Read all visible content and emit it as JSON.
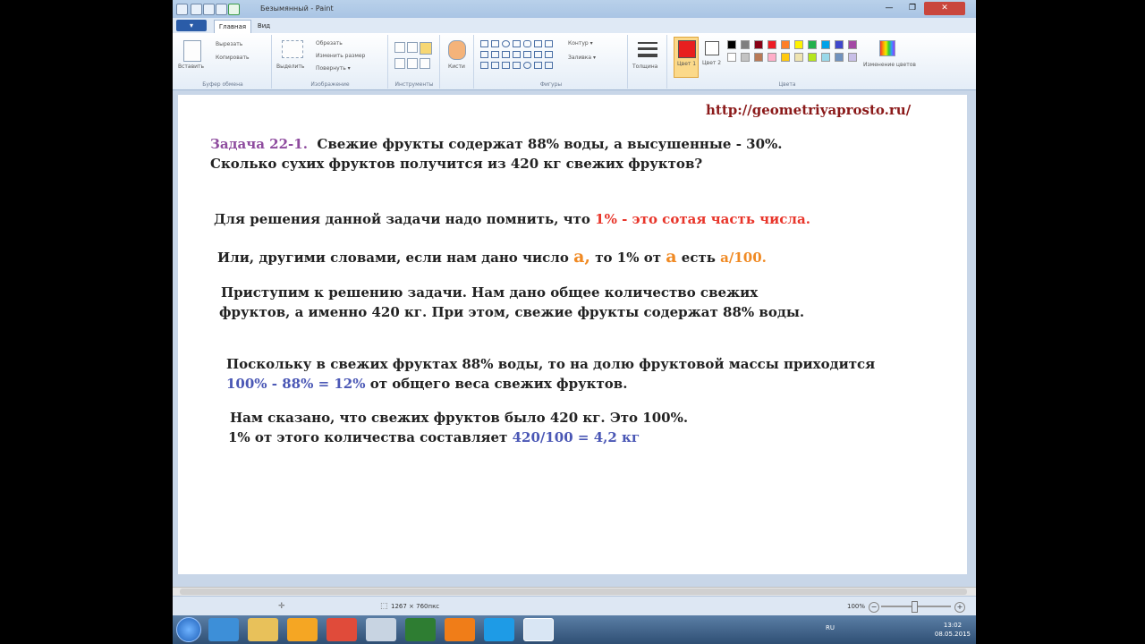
{
  "window": {
    "title": "Безымянный - Paint",
    "controls": [
      "—",
      "❐",
      "✕"
    ]
  },
  "tabs": {
    "file_label": "▾",
    "items": [
      "Главная",
      "Вид"
    ]
  },
  "ribbon": {
    "clipboard": {
      "paste": "Вставить",
      "cut": "Вырезать",
      "copy": "Копировать",
      "label": "Буфер обмена"
    },
    "image": {
      "select": "Выделить",
      "crop": "Обрезать",
      "resize": "Изменить размер",
      "rotate": "Повернуть ▾",
      "label": "Изображение"
    },
    "tools": {
      "label": "Инструменты"
    },
    "brushes": {
      "label": "Кисти"
    },
    "shapes": {
      "contour": "Контур ▾",
      "fill": "Заливка ▾",
      "label": "Фигуры"
    },
    "size": {
      "label": "Толщина"
    },
    "colors": {
      "color1": "Цвет 1",
      "color2": "Цвет 2",
      "edit": "Изменение цветов",
      "label": "Цвета",
      "color1_hex": "#e81f1f",
      "color2_hex": "#ffffff",
      "palette": [
        "#000000",
        "#7f7f7f",
        "#880015",
        "#ed1c24",
        "#ff7f27",
        "#fff200",
        "#22b14c",
        "#00a2e8",
        "#3f48cc",
        "#a349a4",
        "#ffffff",
        "#c3c3c3",
        "#b97a57",
        "#ffaec9",
        "#ffc90e",
        "#efe4b0",
        "#b5e61d",
        "#99d9ea",
        "#7092be",
        "#c8bfe7"
      ]
    }
  },
  "canvas": {
    "url": "http://geometriyaprosto.ru/",
    "task_label": "Задача 22-1.",
    "task_text": "Свежие фрукты содержат 88% воды, а высушенные - 30%.",
    "task_text2": "Сколько сухих фруктов получится из 420 кг свежих фруктов?",
    "p1_text": "Для решения данной задачи надо помнить, что",
    "p1_highlight": "1% - это сотая часть числа.",
    "p2_a": "Или, другими словами, если нам дано число",
    "p2_var1": "a,",
    "p2_b": "то 1% от",
    "p2_var2": "a",
    "p2_c": "есть",
    "p2_frac": "a/100.",
    "p3_line1": "Приступим к решению задачи.  Нам дано общее количество свежих",
    "p3_line2": "фруктов, а именно 420 кг. При этом, свежие фрукты содержат 88% воды.",
    "p4_line1": "Поскольку в свежих фруктах 88% воды, то на долю фруктовой массы приходится",
    "p4_formula": "100% - 88% = 12%",
    "p4_rest": "от общего веса свежих фруктов.",
    "p5_line1": "Нам сказано, что свежих фруктов было 420 кг. Это 100%.",
    "p5_text": "1% от этого количества составляет",
    "p5_formula": "420/100 = 4,2 кг"
  },
  "status": {
    "size": "1267 × 760пкс",
    "zoom": "100%"
  },
  "clock": {
    "time": "13:02",
    "date": "08.05.2015",
    "lang": "RU"
  }
}
